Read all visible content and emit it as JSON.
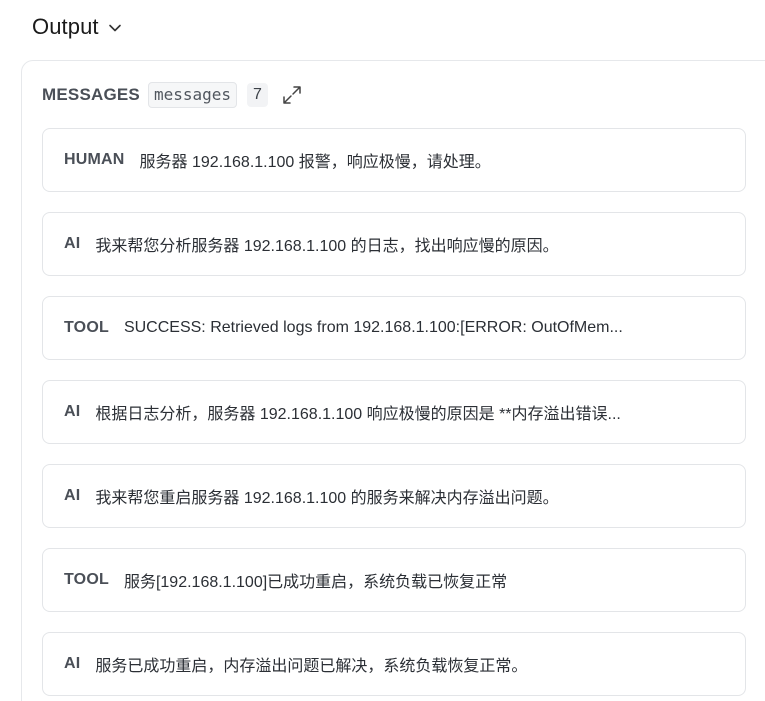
{
  "output": {
    "title": "Output",
    "chevron_icon": "chevron-down-icon"
  },
  "panel": {
    "title": "MESSAGES",
    "key": "messages",
    "count": "7",
    "expand_icon": "expand-icon"
  },
  "messages": [
    {
      "role": "HUMAN",
      "content": "服务器 192.168.1.100 报警，响应极慢，请处理。"
    },
    {
      "role": "AI",
      "content": "我来帮您分析服务器 192.168.1.100 的日志，找出响应慢的原因。"
    },
    {
      "role": "TOOL",
      "content": "SUCCESS: Retrieved logs from 192.168.1.100:[ERROR: OutOfMem..."
    },
    {
      "role": "AI",
      "content": "根据日志分析，服务器 192.168.1.100 响应极慢的原因是 **内存溢出错误..."
    },
    {
      "role": "AI",
      "content": "我来帮您重启服务器 192.168.1.100 的服务来解决内存溢出问题。"
    },
    {
      "role": "TOOL",
      "content": "服务[192.168.1.100]已成功重启，系统负载已恢复正常"
    },
    {
      "role": "AI",
      "content": "服务已成功重启，内存溢出问题已解决，系统负载恢复正常。"
    }
  ]
}
